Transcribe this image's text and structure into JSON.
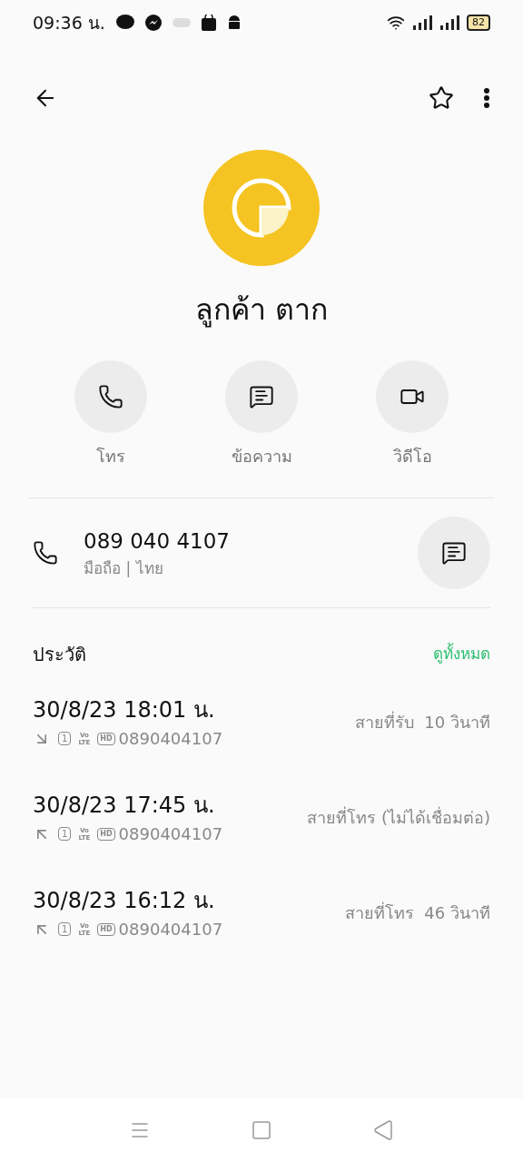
{
  "status_bar": {
    "time": "09:36 น.",
    "battery": "82"
  },
  "contact": {
    "name": "ลูกค้า ตาก"
  },
  "actions": [
    {
      "kind": "call",
      "label": "โทร"
    },
    {
      "kind": "message",
      "label": "ข้อความ"
    },
    {
      "kind": "video",
      "label": "วิดีโอ"
    }
  ],
  "phone": {
    "number": "089 040 4107",
    "detail": "มือถือ | ไทย"
  },
  "history": {
    "title": "ประวัติ",
    "view_all": "ดูทั้งหมด",
    "calls": [
      {
        "time": "30/8/23 18:01 น.",
        "kind": "incoming",
        "sim": "1",
        "volte_top": "Vo",
        "volte_bottom": "LTE",
        "hd": "HD",
        "number": "0890404107",
        "status": "สายที่รับ  10 วินาที"
      },
      {
        "time": "30/8/23 17:45 น.",
        "kind": "outgoing",
        "sim": "1",
        "volte_top": "Vo",
        "volte_bottom": "LTE",
        "hd": "HD",
        "number": "0890404107",
        "status": "สายที่โทร (ไม่ได้เชื่อมต่อ)"
      },
      {
        "time": "30/8/23 16:12 น.",
        "kind": "outgoing",
        "sim": "1",
        "volte_top": "Vo",
        "volte_bottom": "LTE",
        "hd": "HD",
        "number": "0890404107",
        "status": "สายที่โทร  46 วินาที"
      }
    ]
  }
}
